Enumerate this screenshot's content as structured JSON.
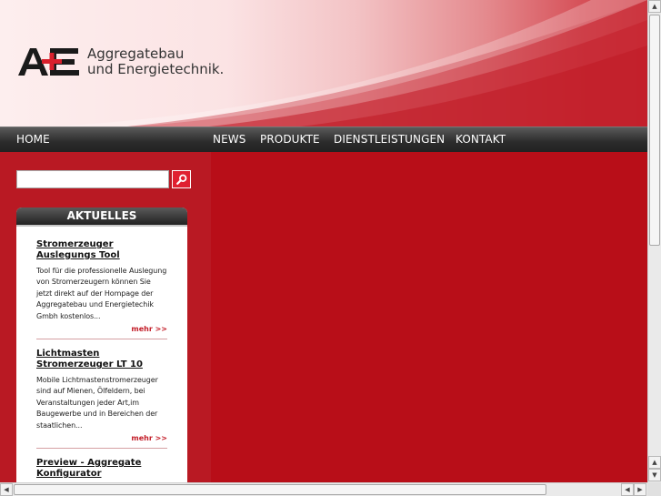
{
  "brand": {
    "logo_text": "AE",
    "line1": "Aggregatebau",
    "line2": "und Energietechnik."
  },
  "nav": {
    "home": "HOME",
    "news": "NEWS",
    "produkte": "PRODUKTE",
    "dienstleistungen": "DIENSTLEISTUNGEN",
    "kontakt": "KONTAKT"
  },
  "search": {
    "value": "",
    "placeholder": ""
  },
  "aktuelles": {
    "heading": "AKTUELLES",
    "items": [
      {
        "title": "Stromerzeuger Auslegungs Tool",
        "text": "Tool für die professionelle Auslegung von Stromerzeugern können Sie jetzt direkt auf der Hompage der Aggregatebau und Energietechik Gmbh kostenlos...",
        "more": "mehr >>"
      },
      {
        "title": "Lichtmasten Stromerzeuger LT 10",
        "text": "Mobile Lichtmastenstromerzeuger sind auf Mienen, Ölfeldern, bei Veranstaltungen jeder Art,im Baugewerbe und in Bereichen der staatlichen...",
        "more": "mehr >>"
      },
      {
        "title": "Preview - Aggregate Konfigurator",
        "text": "",
        "more": ""
      }
    ]
  },
  "colors": {
    "brand_red": "#b80e18",
    "nav_dark": "#2b2b2b",
    "more_red": "#c31d28"
  }
}
